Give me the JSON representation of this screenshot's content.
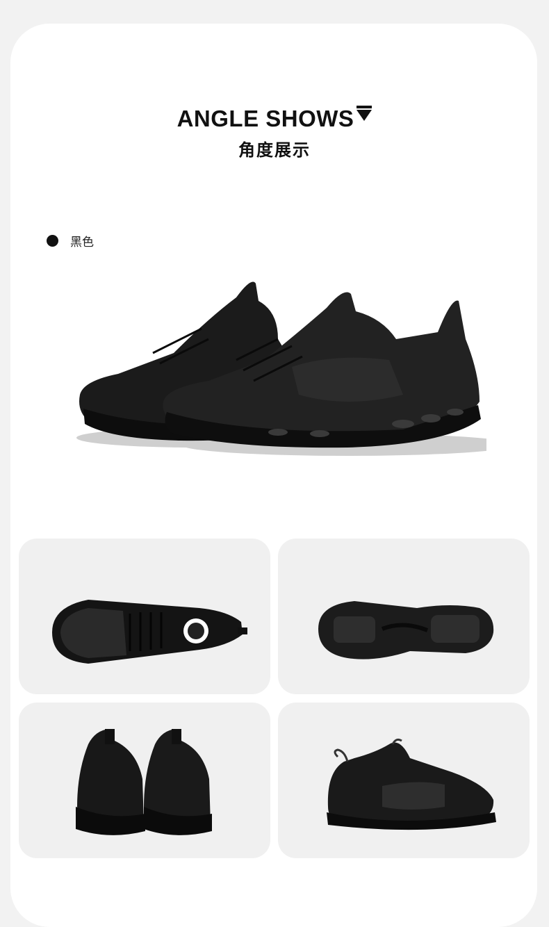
{
  "header": {
    "title": "ANGLE SHOWS",
    "subtitle": "角度展示"
  },
  "color_option": {
    "label": "黑色",
    "swatch_color": "#111111"
  },
  "images": [
    {
      "name": "hero-pair",
      "icon": "shoe-pair-side-image"
    },
    {
      "name": "top-view",
      "icon": "shoe-top-image"
    },
    {
      "name": "sole-view",
      "icon": "shoe-sole-image"
    },
    {
      "name": "back-view",
      "icon": "shoe-back-image"
    },
    {
      "name": "side-view",
      "icon": "shoe-side-image"
    }
  ],
  "colors": {
    "page_bg": "#f2f2f2",
    "card_bg": "#ffffff",
    "tile_bg": "#f0f0f0",
    "text": "#111111"
  }
}
